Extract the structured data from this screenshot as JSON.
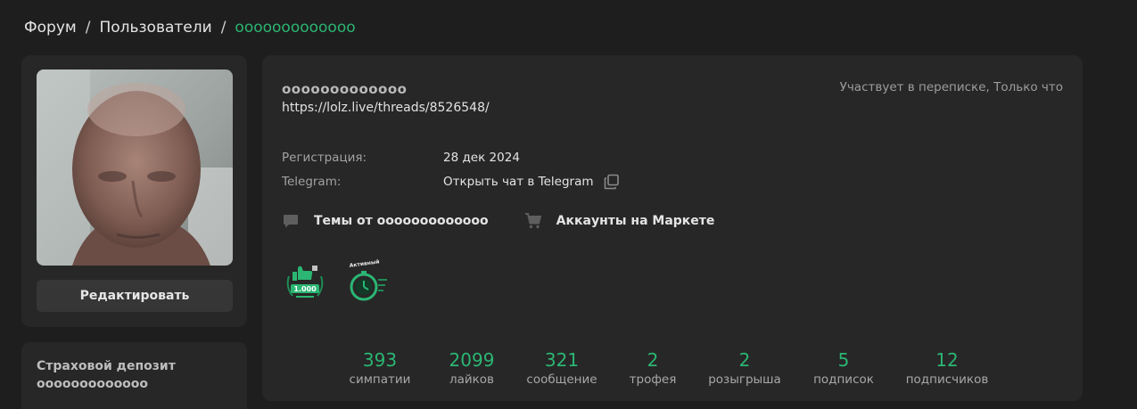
{
  "breadcrumb": {
    "forum": "Форум",
    "users": "Пользователи",
    "current": "ооооооооооооо",
    "separator": "/"
  },
  "sidebar": {
    "edit_label": "Редактировать",
    "deposit_title": "Страховой депозит",
    "deposit_value": "ооооооооооооо"
  },
  "profile": {
    "username": "ооооооооооооо",
    "link": "https://lolz.live/threads/8526548/",
    "status": "Участвует в переписке, Только что",
    "registration_label": "Регистрация:",
    "registration_value": "28 дек 2024",
    "telegram_label": "Telegram:",
    "telegram_value": "Открыть чат в Telegram",
    "topics_link": "Темы от ооооооооооооо",
    "market_link": "Аккаунты на Маркете"
  },
  "trophies": [
    {
      "icon": "likes-1000-trophy-icon",
      "text": "1.000"
    },
    {
      "icon": "active-user-trophy-icon",
      "text": "Активный"
    }
  ],
  "stats": [
    {
      "value": "393",
      "label": "симпатии"
    },
    {
      "value": "2099",
      "label": "лайков"
    },
    {
      "value": "321",
      "label": "сообщение"
    },
    {
      "value": "2",
      "label": "трофея"
    },
    {
      "value": "2",
      "label": "розыгрыша"
    },
    {
      "value": "5",
      "label": "подписок"
    },
    {
      "value": "12",
      "label": "подписчиков"
    }
  ],
  "colors": {
    "accent": "#2bb673",
    "background": "#1e1e1e",
    "card": "#272727"
  }
}
